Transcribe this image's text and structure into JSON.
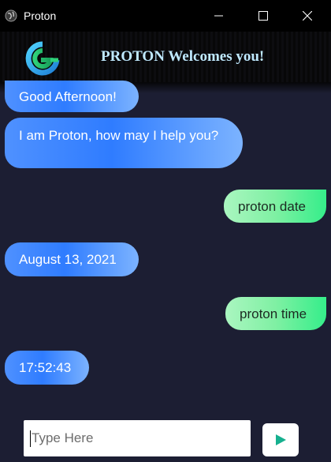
{
  "window": {
    "title": "Proton",
    "icon": "globe-icon",
    "controls": [
      "minimize-icon",
      "maximize-icon",
      "close-icon"
    ]
  },
  "header": {
    "logo": "proton-logo",
    "title": "PROTON Welcomes you!"
  },
  "messages": [
    {
      "sender": "bot",
      "text": "Good Afternoon!"
    },
    {
      "sender": "bot",
      "text": "I am Proton, how may I help you?"
    },
    {
      "sender": "user",
      "text": "proton date"
    },
    {
      "sender": "bot",
      "text": "August 13, 2021"
    },
    {
      "sender": "user",
      "text": "proton time"
    },
    {
      "sender": "bot",
      "text": "17:52:43"
    }
  ],
  "input": {
    "placeholder": "Type Here",
    "value": ""
  },
  "send_button": {
    "icon": "send-icon"
  },
  "colors": {
    "background": "#1c1e33",
    "bot_bubble": "#2f7cff",
    "user_bubble": "#35ee8a",
    "header_title": "#bfe9ff",
    "send_icon": "#16b08f"
  }
}
